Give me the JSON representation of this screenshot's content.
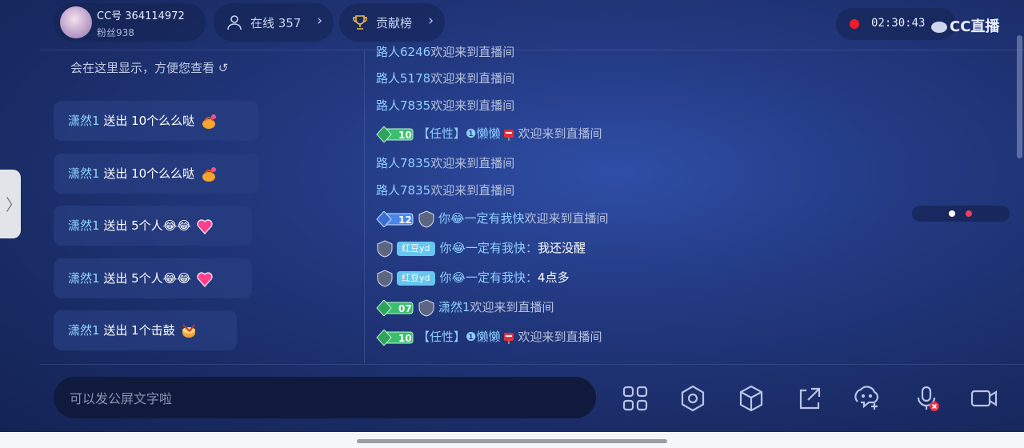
{
  "header": {
    "cc_id": "CC号 364114972",
    "fans": "粉丝938",
    "online_label": "在线 357",
    "rank_label": "贡献榜",
    "timer": "02:30:43",
    "logo": "CC直播"
  },
  "gifts": {
    "tip": "会在这里显示，方便您查看 ↺",
    "items": [
      {
        "user": "潇然1",
        "action": " 送出 10个么么哒",
        "gift_icon": "kiss-gift-icon"
      },
      {
        "user": "潇然1",
        "action": " 送出 10个么么哒",
        "gift_icon": "kiss-gift-icon"
      },
      {
        "user": "潇然1",
        "action": " 送出 5个人😂😂",
        "gift_icon": "heart-gift-icon"
      },
      {
        "user": "潇然1",
        "action": " 送出 5个人😂😂",
        "gift_icon": "heart-gift-icon"
      },
      {
        "user": "潇然1",
        "action": " 送出 1个击鼓",
        "gift_icon": "drum-gift-icon"
      }
    ]
  },
  "chat": {
    "welcome": "欢迎来到直播间",
    "messages": [
      {
        "user": "路人6246"
      },
      {
        "user": "路人5178"
      },
      {
        "user": "路人7835"
      },
      {
        "level": "10",
        "user": "【任性】❶懒懒"
      },
      {
        "user": "路人7835"
      },
      {
        "user": "路人7835"
      },
      {
        "level": "12",
        "user": "你😂一定有我快"
      },
      {
        "tag": "红豆yd",
        "user": "你😂一定有我快：",
        "text": "我还没醒"
      },
      {
        "tag": "红豆yd",
        "user": "你😂一定有我快：",
        "text": "4点多"
      },
      {
        "level": "07",
        "user": "潇然1"
      },
      {
        "level": "10",
        "user": "【任性】❶懒懒"
      }
    ]
  },
  "input": {
    "placeholder": "可以发公屏文字啦"
  },
  "colors": {
    "accent_red": "#f01c2a",
    "username": "#8fcfff",
    "level_green": "#3bbf6e",
    "level_blue": "#4a86e8",
    "tag_blue": "#66c6ee"
  }
}
